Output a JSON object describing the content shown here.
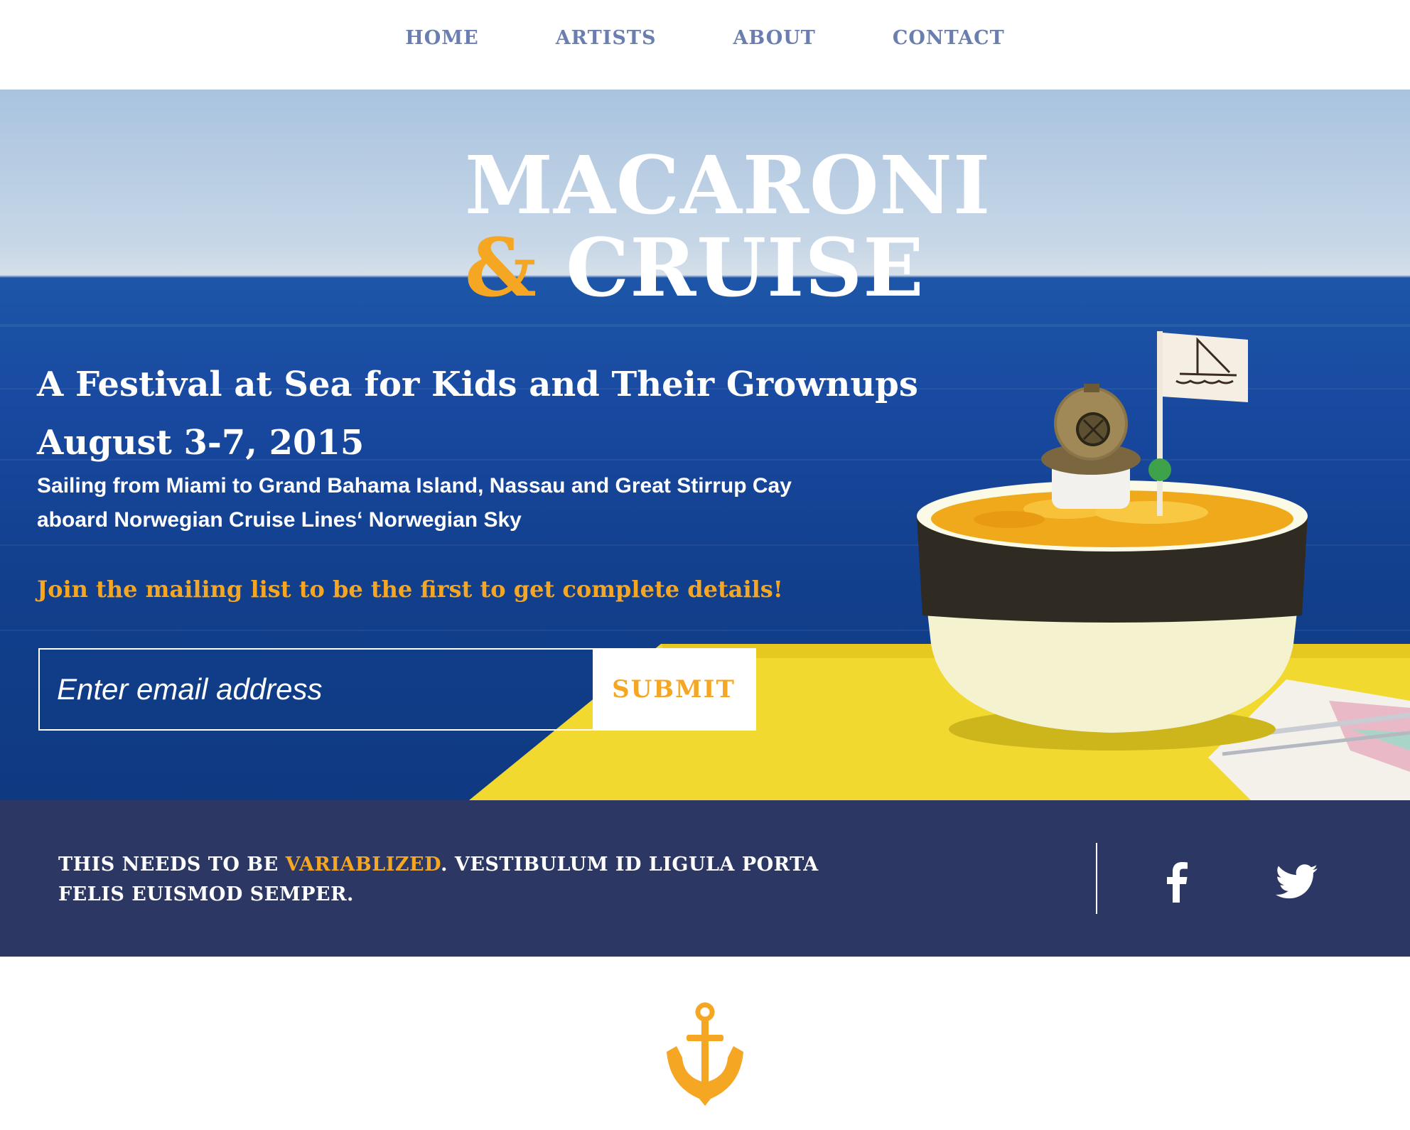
{
  "nav": {
    "items": [
      {
        "label": "HOME"
      },
      {
        "label": "ARTISTS"
      },
      {
        "label": "ABOUT"
      },
      {
        "label": "CONTACT"
      }
    ]
  },
  "hero": {
    "title_line1": "MACARONI",
    "title_amp": "&",
    "title_line2": "CRUISE",
    "tagline_line1": "A Festival at Sea for Kids and Their Grownups",
    "tagline_line2": "August 3-7, 2015",
    "subline_line1": "Sailing from Miami to Grand Bahama Island, Nassau and Great Stirrup Cay",
    "subline_line2": "aboard Norwegian Cruise Lines‘ Norwegian Sky",
    "cta": "Join the mailing list to be the first to get complete details!",
    "email_placeholder": "Enter email address",
    "email_value": "",
    "submit_label": "SUBMIT"
  },
  "band": {
    "text_before": "THIS NEEDS TO BE ",
    "text_highlight": "VARIABLIZED",
    "text_after": ". VESTIBULUM ID LIGULA PORTA FELIS EUISMOD SEMPER.",
    "social": [
      {
        "icon": "facebook-icon"
      },
      {
        "icon": "twitter-icon"
      }
    ]
  },
  "colors": {
    "accent": "#f5a623",
    "nav_text": "#6a7fb0",
    "band_bg": "#2c3863",
    "sea": "#1849a0"
  },
  "footer": {
    "icon": "anchor-icon"
  }
}
